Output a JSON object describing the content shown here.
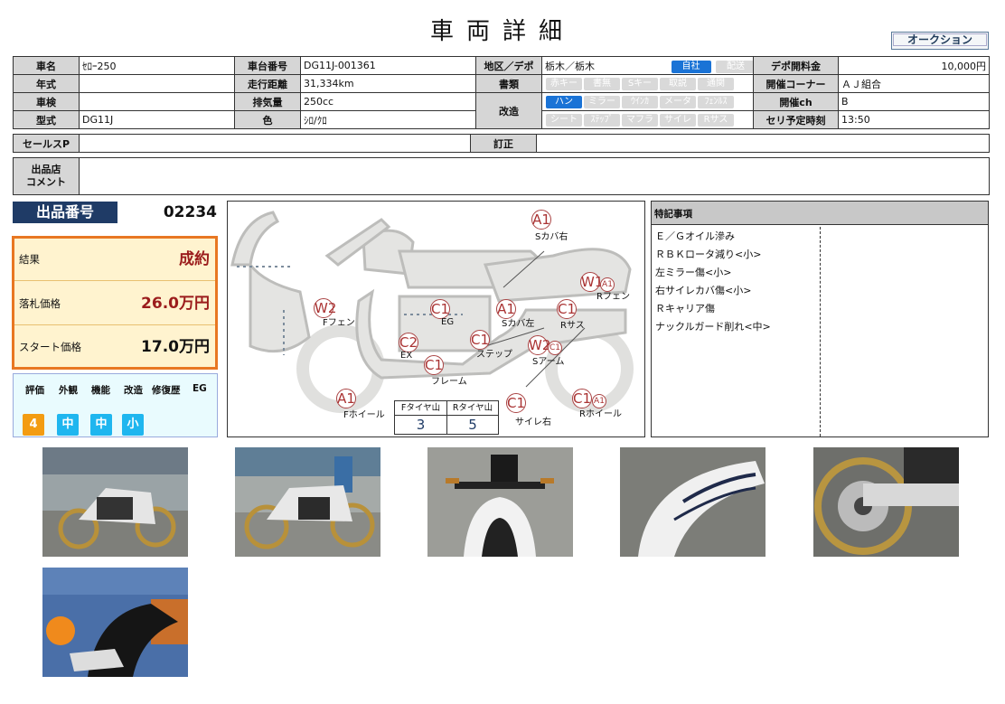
{
  "title": "車両詳細",
  "auction_button": "オークション",
  "spec": {
    "name_label": "車名",
    "name": "ｾﾛｰ250",
    "year_label": "年式",
    "year": "",
    "inspection_label": "車検",
    "inspection": "",
    "model_label": "型式",
    "model": "DG11J",
    "frame_label": "車台番号",
    "frame": "DG11J-001361",
    "mileage_label": "走行距離",
    "mileage": "31,334km",
    "displacement_label": "排気量",
    "displacement": "250cc",
    "color_label": "色",
    "color": "ｼﾛ/ｸﾛ",
    "region_label": "地区／デポ",
    "region": "栃木／栃木",
    "region_pills": [
      "自社",
      "配送"
    ],
    "docs_label": "書類",
    "docs_pills": [
      "赤キー",
      "書無",
      "Sキー",
      "取説",
      "通関"
    ],
    "mod_label": "改造",
    "mod_pills_row1": [
      "ハン",
      "ミラー",
      "ｳｲﾝｶ",
      "メータ",
      "ﾌｪﾝﾙｽ"
    ],
    "mod_pills_row2": [
      "シート",
      "ｽﾃｯﾌﾟ",
      "マフラ",
      "サイレ",
      "Rサス"
    ],
    "depot_fee_label": "デポ開料金",
    "depot_fee": "10,000円",
    "corner_label": "開催コーナー",
    "corner": "ＡＪ組合",
    "channel_label": "開催ch",
    "channel": "B",
    "auction_time_label": "セリ予定時刻",
    "auction_time": "13:50",
    "sales_label": "セールスP",
    "sales": "",
    "correction_label": "訂正",
    "correction": "",
    "comment_label_1": "出品店",
    "comment_label_2": "コメント",
    "comment": ""
  },
  "lot": {
    "label": "出品番号",
    "number": "02234"
  },
  "result": {
    "result_label": "結果",
    "result_value": "成約",
    "sold_label": "落札価格",
    "sold_value": "26.0万円",
    "start_label": "スタート価格",
    "start_value": "17.0万円"
  },
  "evaluation": {
    "headers": [
      "評価",
      "外観",
      "機能",
      "改造",
      "修復歴",
      "EG"
    ],
    "values": [
      "4",
      "中",
      "中",
      "小"
    ],
    "colors": {
      "grade": "#f39c12",
      "level": "#1fb6ef"
    }
  },
  "diagram": {
    "marks": [
      {
        "code": "A1",
        "label": "Sカバ右"
      },
      {
        "code": "W1",
        "sub": "A1",
        "label": "Rフェン"
      },
      {
        "code": "W2",
        "label": "Fフェン"
      },
      {
        "code": "C1",
        "label": "EG"
      },
      {
        "code": "A1",
        "label": "Sカバ左"
      },
      {
        "code": "C1",
        "label": "Rサス"
      },
      {
        "code": "C2",
        "label": "EX"
      },
      {
        "code": "C1",
        "label": "ステップ"
      },
      {
        "code": "W2",
        "sub": "C1",
        "label": "Sアーム"
      },
      {
        "code": "C1",
        "label": "フレーム"
      },
      {
        "code": "A1",
        "label": "Fホイール"
      },
      {
        "code": "C1",
        "label": "サイレ右"
      },
      {
        "code": "C1",
        "sub": "A1",
        "label": "Rホイール"
      }
    ],
    "tires": {
      "front_label": "Fタイヤ山",
      "front": "3",
      "rear_label": "Rタイヤ山",
      "rear": "5"
    }
  },
  "notes": {
    "header": "特記事項",
    "items": [
      "Ｅ／Ｇオイル滲み",
      "ＲＢＫロータ減り<小>",
      "左ミラー傷<小>",
      "右サイレカバ傷<小>",
      "Ｒキャリア傷",
      "ナックルガード削れ<中>"
    ]
  },
  "colors": {
    "navy": "#1f3b66",
    "accent_orange": "#e87722",
    "result_red": "#9b1c1c",
    "pill_blue": "#1a73d6"
  }
}
